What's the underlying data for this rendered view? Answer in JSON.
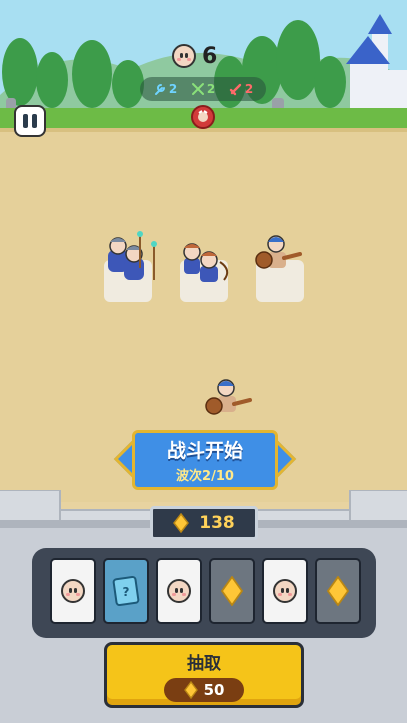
{
  "hud": {
    "population": "6",
    "stats": [
      {
        "icon": "wrench-icon",
        "value": "2",
        "color": "#6fd3ff"
      },
      {
        "icon": "crossbow-icon",
        "value": "2",
        "color": "#8ae07a"
      },
      {
        "icon": "sword-icon",
        "value": "2",
        "color": "#ff6a6a"
      }
    ]
  },
  "banner": {
    "title": "战斗开始",
    "wave": "波次2/10"
  },
  "gems": {
    "amount": "138"
  },
  "cards": [
    {
      "kind": "face",
      "style": "light"
    },
    {
      "kind": "rune",
      "style": "blue"
    },
    {
      "kind": "face",
      "style": "light"
    },
    {
      "kind": "gem",
      "style": "dark"
    },
    {
      "kind": "face",
      "style": "light"
    },
    {
      "kind": "gem",
      "style": "dark"
    }
  ],
  "draw_button": {
    "label": "抽取",
    "cost": "50"
  },
  "colors": {
    "banner_blue": "#3f8fe6",
    "gold": "#f5c419",
    "sand": "#e5d09a",
    "grass": "#6dbb46"
  }
}
